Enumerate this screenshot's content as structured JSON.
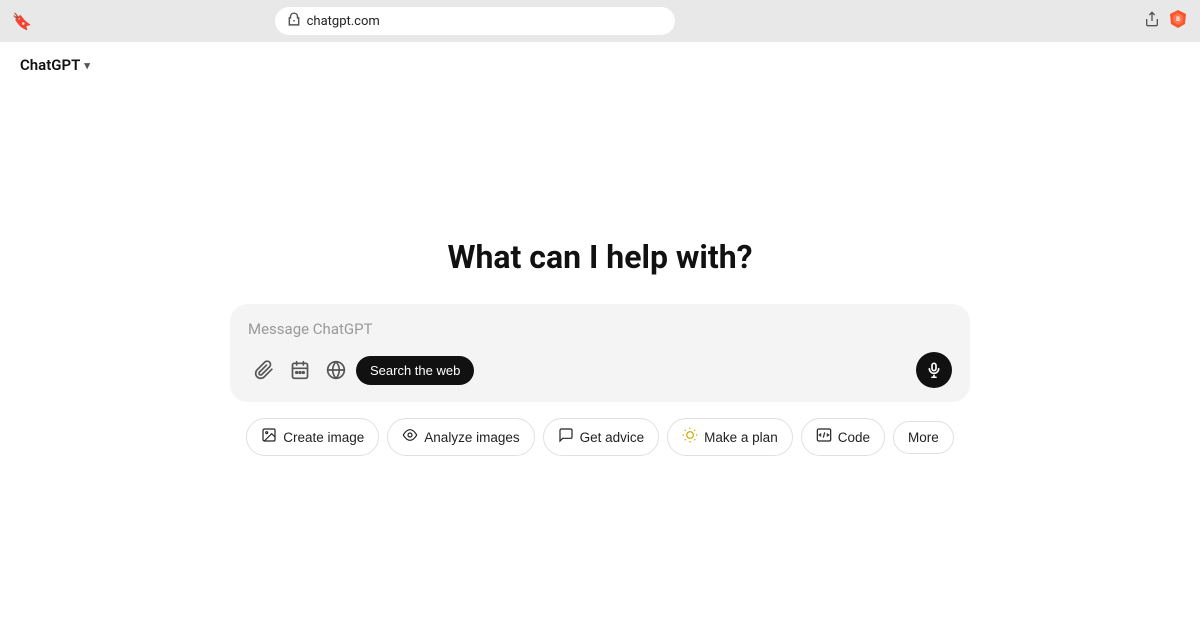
{
  "browser": {
    "bookmark_icon": "🔖",
    "url_icon": "🔄",
    "url": "chatgpt.com",
    "share_icon": "↑",
    "brave_icon": "🦁"
  },
  "header": {
    "title": "ChatGPT",
    "chevron": "▾"
  },
  "main": {
    "headline": "What can I help with?",
    "input_placeholder": "Message ChatGPT",
    "toolbar": {
      "attach_icon": "📎",
      "calendar_icon": "🗓",
      "globe_icon": "🌐",
      "search_web_label": "Search the web",
      "mic_icon": "🎙"
    },
    "quick_actions": [
      {
        "id": "create-image",
        "icon": "🖼",
        "label": "Create image"
      },
      {
        "id": "analyze-images",
        "icon": "👁",
        "label": "Analyze images"
      },
      {
        "id": "get-advice",
        "icon": "💬",
        "label": "Get advice"
      },
      {
        "id": "make-a-plan",
        "icon": "💡",
        "label": "Make a plan"
      },
      {
        "id": "code",
        "icon": "💻",
        "label": "Code"
      },
      {
        "id": "more",
        "icon": "",
        "label": "More"
      }
    ]
  }
}
